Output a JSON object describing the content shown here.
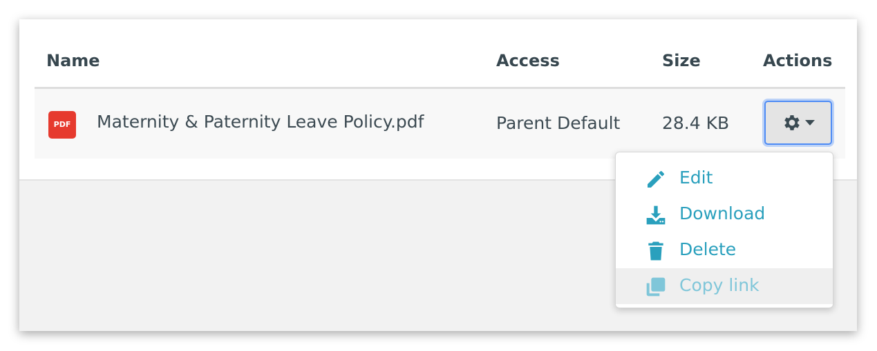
{
  "table": {
    "headers": {
      "name": "Name",
      "access": "Access",
      "size": "Size",
      "actions": "Actions"
    },
    "rows": [
      {
        "file_type_badge": "PDF",
        "name": "Maternity & Paternity Leave Policy.pdf",
        "access": "Parent Default",
        "size": "28.4 KB",
        "actions_icon": "gear-icon"
      }
    ]
  },
  "actions_menu": {
    "items": [
      {
        "label": "Edit",
        "icon": "pencil-icon"
      },
      {
        "label": "Download",
        "icon": "download-icon"
      },
      {
        "label": "Delete",
        "icon": "trash-icon"
      },
      {
        "label": "Copy link",
        "icon": "copy-icon",
        "hovered": true
      }
    ]
  },
  "colors": {
    "accent": "#2aa0bd",
    "accent_hover_text": "#7fc6d9",
    "pdf_badge": "#e63a2e",
    "focus_ring": "#4d8bf5",
    "header_text": "#37474f"
  }
}
